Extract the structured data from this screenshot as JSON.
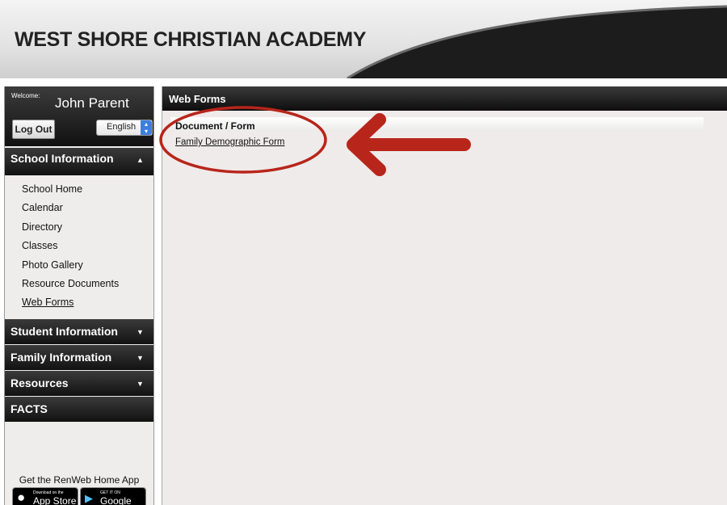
{
  "header": {
    "school_name": "WEST SHORE CHRISTIAN ACADEMY"
  },
  "sidebar": {
    "welcome_label": "Welcome:",
    "user_name": "John Parent",
    "logout_label": "Log Out",
    "language": "English",
    "sections": [
      {
        "label": "School Information",
        "expanded": true
      },
      {
        "label": "Student Information",
        "expanded": false
      },
      {
        "label": "Family Information",
        "expanded": false
      },
      {
        "label": "Resources",
        "expanded": false
      },
      {
        "label": "FACTS"
      }
    ],
    "school_items": [
      "School Home",
      "Calendar",
      "Directory",
      "Classes",
      "Photo Gallery",
      "Resource Documents",
      "Web Forms"
    ],
    "active_item": "Web Forms",
    "app_promo": "Get the RenWeb Home App",
    "app_store": {
      "small": "Download on the",
      "big": "App Store"
    },
    "google_play": {
      "small": "GET IT ON",
      "big": "Google play"
    }
  },
  "main": {
    "title": "Web Forms",
    "column_header": "Document / Form",
    "forms": [
      "Family Demographic Form"
    ]
  },
  "colors": {
    "dark_bar": "#121212",
    "annotation": "#b8251b",
    "lang_accent": "#3d7de0"
  }
}
